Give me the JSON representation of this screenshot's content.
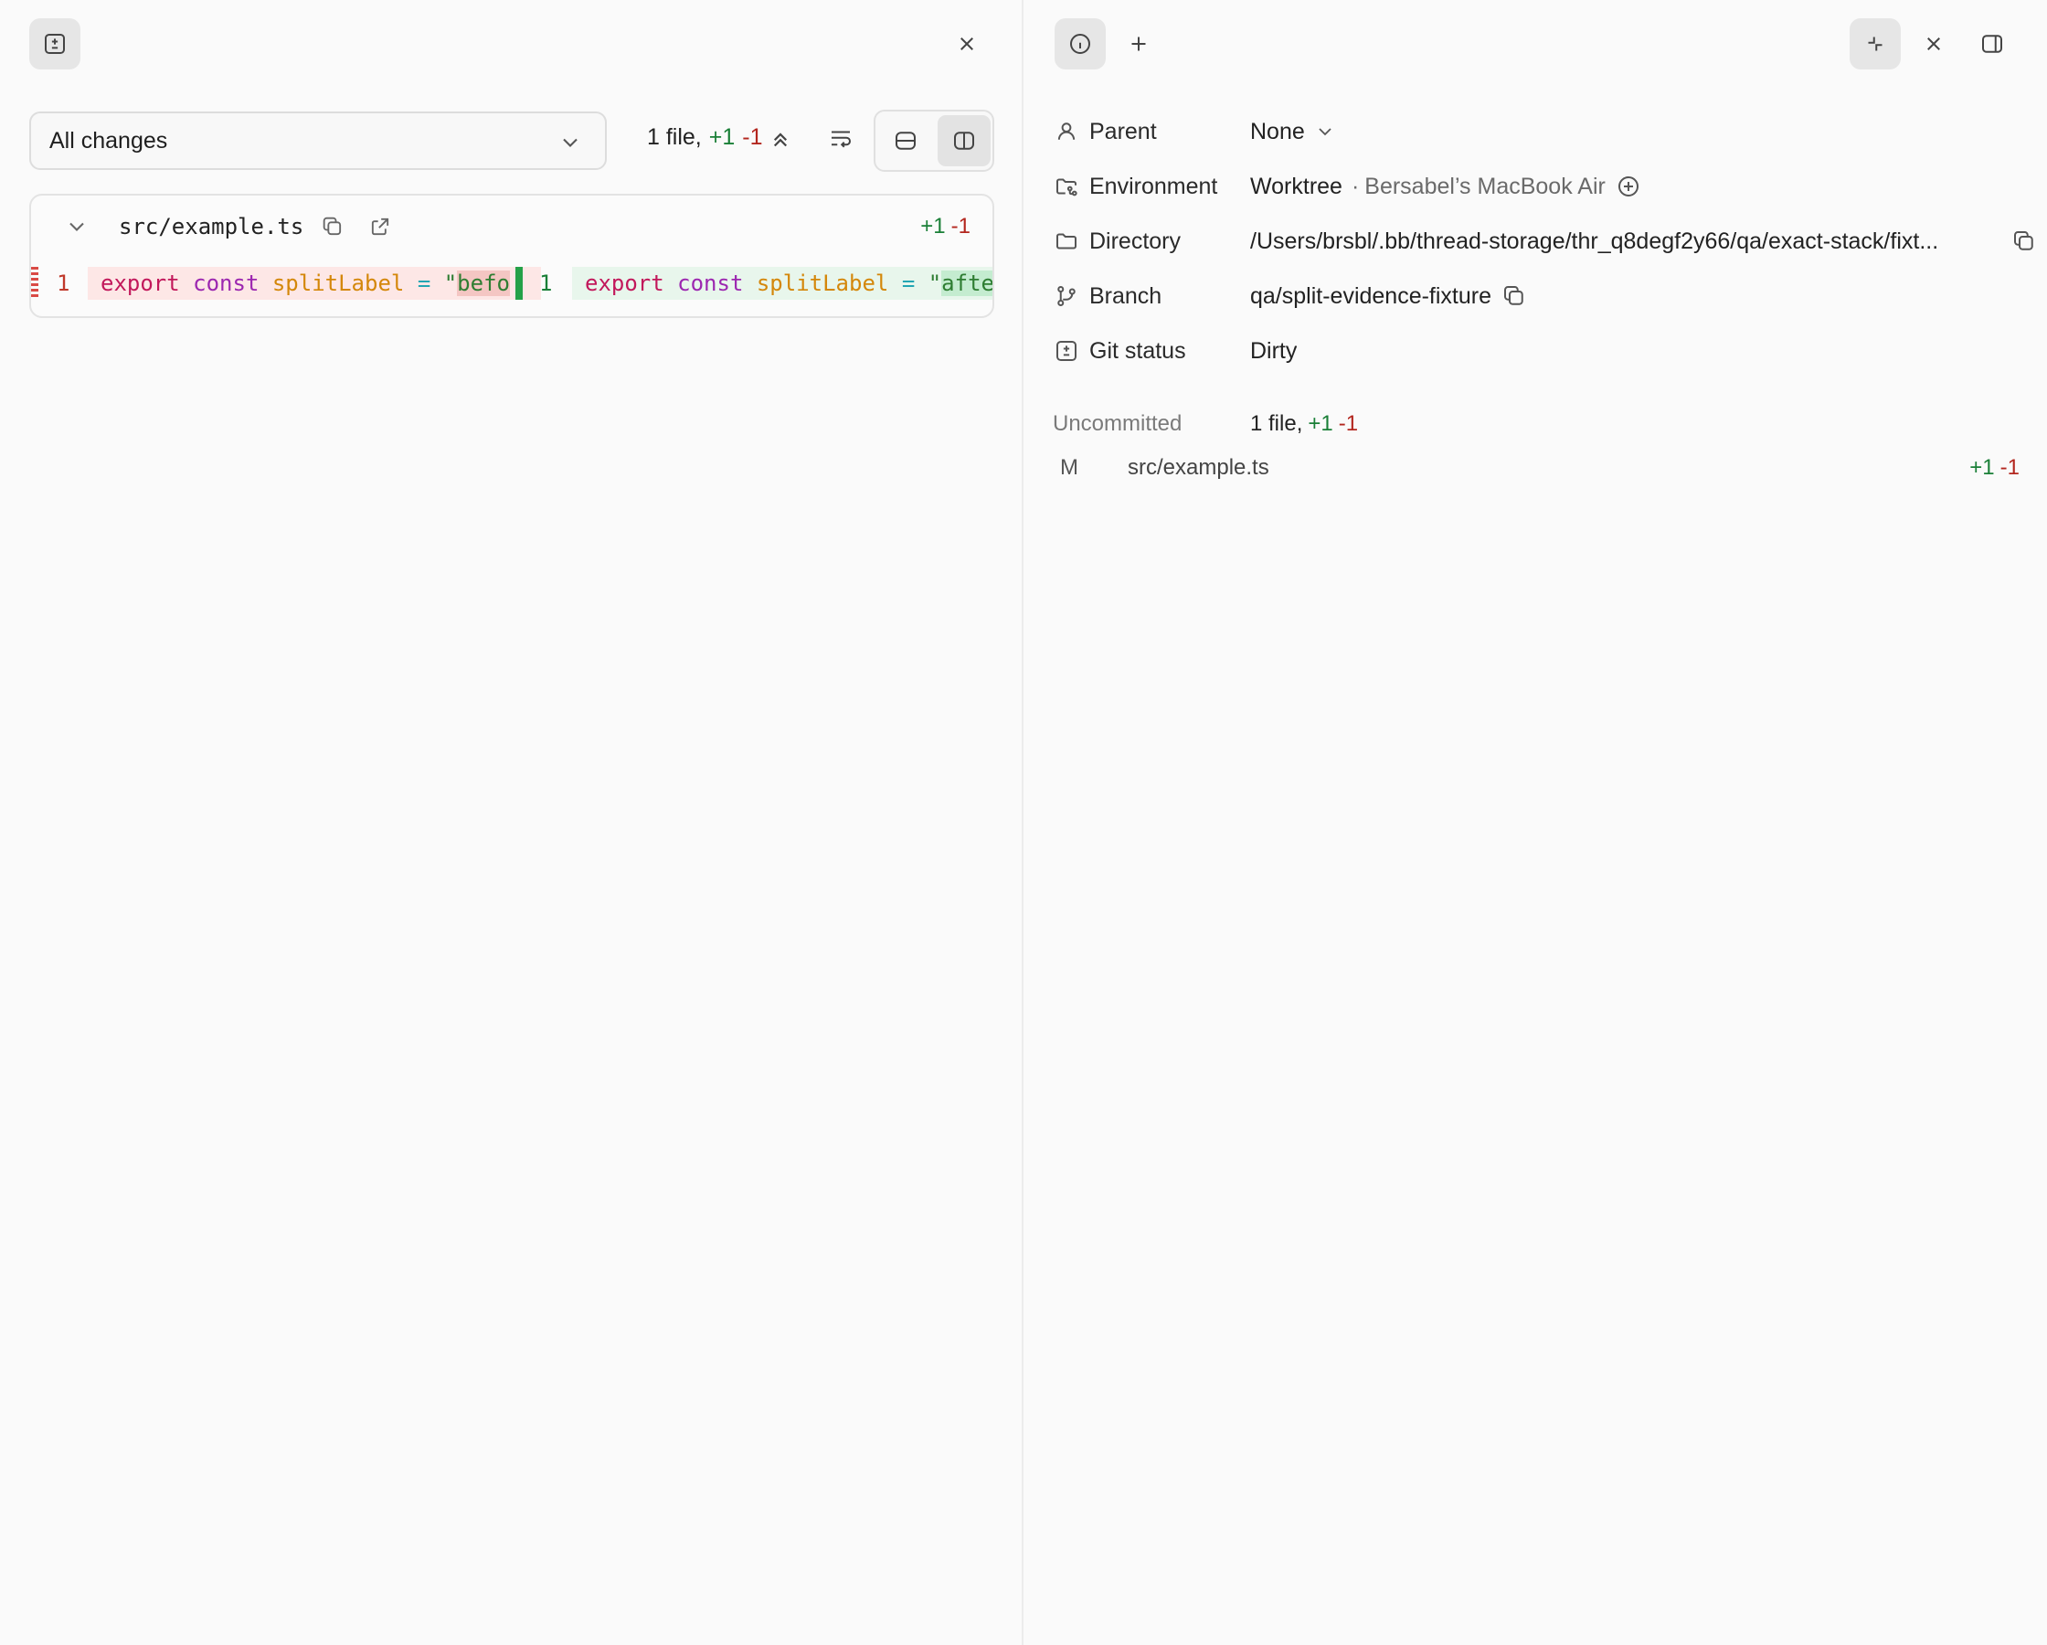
{
  "left": {
    "filter_label": "All changes",
    "summary": {
      "files": "1 file,",
      "added": "+1",
      "removed": "-1"
    },
    "file": {
      "name": "src/example.ts",
      "added": "+1",
      "removed": "-1"
    },
    "diff": {
      "old_line": "1",
      "new_line": "1",
      "old_code": {
        "kw": "export",
        "const": "const",
        "name": "splitLabel",
        "op": "=",
        "quote": "\"",
        "str": "befo"
      },
      "new_code": {
        "kw": "export",
        "const": "const",
        "name": "splitLabel",
        "op": "=",
        "quote": "\"",
        "str": "afte"
      }
    }
  },
  "right": {
    "rows": [
      {
        "label": "Parent",
        "value": "None"
      },
      {
        "label": "Environment",
        "value": "Worktree",
        "sep": "·",
        "extra": "Bersabel’s MacBook Air"
      },
      {
        "label": "Directory",
        "value": "/Users/brsbl/.bb/thread-storage/thr_q8degf2y66/qa/exact-stack/fixt..."
      },
      {
        "label": "Branch",
        "value": "qa/split-evidence-fixture"
      },
      {
        "label": "Git status",
        "value": "Dirty"
      }
    ],
    "uncommitted": {
      "label": "Uncommitted",
      "files": "1 file,",
      "added": "+1",
      "removed": "-1",
      "file": {
        "status": "M",
        "path": "src/example.ts",
        "added": "+1",
        "removed": "-1"
      }
    }
  },
  "colors": {
    "added": "#1a7f37",
    "removed": "#b3261e",
    "dirty": "#a31515"
  }
}
